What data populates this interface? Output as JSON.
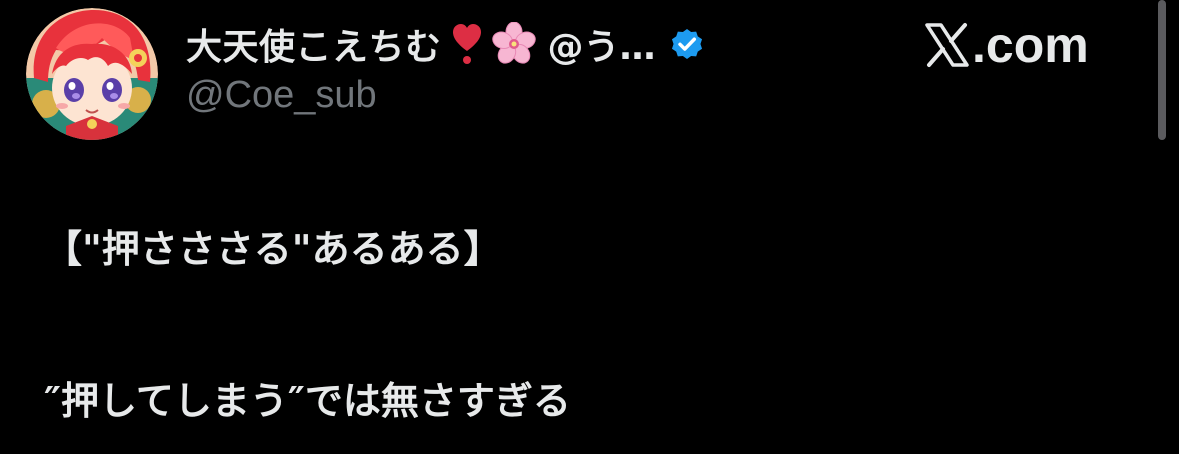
{
  "author": {
    "display_name": "大天使こえちむ",
    "emoji_heart": "heart-emoji",
    "emoji_flower": "cherry-blossom-emoji",
    "name_suffix": "@う…",
    "verified": true,
    "handle": "@Coe_sub"
  },
  "site": {
    "logo_icon": "x-logo-icon",
    "domain": ".com"
  },
  "tweet": {
    "lines": [
      "【\"押さささる\"あるある】",
      "″押してしまう″では無さすぎる"
    ]
  },
  "colors": {
    "background": "#000000",
    "text_primary": "#e7e9ea",
    "text_secondary": "#71767b",
    "verified_blue": "#1d9bf0",
    "heart_red": "#dd2e44",
    "blossom_pink": "#f7b6d2"
  }
}
